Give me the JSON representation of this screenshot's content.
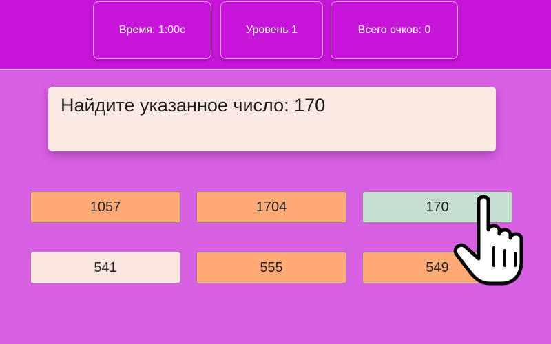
{
  "header": {
    "time": "Время: 1:00с",
    "level": "Уровень 1",
    "score": "Всего очков: 0"
  },
  "prompt": "Найдите указанное число: 170",
  "tiles": [
    {
      "label": "1057",
      "color": "#ffaa77"
    },
    {
      "label": "1704",
      "color": "#ffaa77"
    },
    {
      "label": "170",
      "color": "#c6ded0"
    },
    {
      "label": "541",
      "color": "#fbe6e0"
    },
    {
      "label": "555",
      "color": "#ffaa77"
    },
    {
      "label": "549",
      "color": "#ffaa77"
    }
  ],
  "cursor_icon": "hand-pointer-icon"
}
